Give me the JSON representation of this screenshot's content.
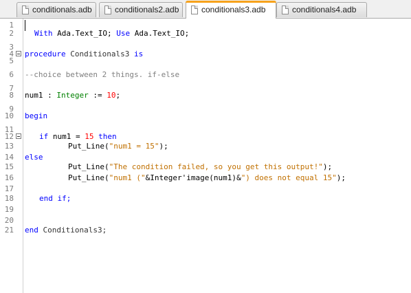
{
  "tabs": [
    {
      "label": "conditionals.adb",
      "active": false
    },
    {
      "label": "conditionals2.adb",
      "active": false
    },
    {
      "label": "conditionals3.adb",
      "active": true
    },
    {
      "label": "conditionals4.adb",
      "active": false
    }
  ],
  "editor": {
    "line_numbers": [
      "1",
      "2",
      "3",
      "4",
      "5",
      "6",
      "7",
      "8",
      "9",
      "10",
      "11",
      "12",
      "13",
      "14",
      "15",
      "16",
      "17",
      "18",
      "19",
      "20",
      "21"
    ],
    "lines": {
      "l2": {
        "with": "With",
        "pkg1": "Ada.Text_IO;",
        "use": "Use",
        "pkg2": "Ada.Text_IO;"
      },
      "l4": {
        "kw": "procedure",
        "name": "Conditionals3",
        "is": "is"
      },
      "l6": {
        "comment": "--choice between 2 things. if-else"
      },
      "l8": {
        "var": "num1 :",
        "type": "Integer",
        "assign": ":=",
        "value": "10",
        "semi": ";"
      },
      "l10": {
        "kw": "begin"
      },
      "l12": {
        "if": "if",
        "cond": "num1 =",
        "value": "15",
        "then": "then"
      },
      "l13": {
        "call": "Put_Line(",
        "str": "\"num1 = 15\"",
        "end": ");"
      },
      "l14": {
        "kw": "else"
      },
      "l15": {
        "call": "Put_Line(",
        "str": "\"The condition failed, so you get this output!\"",
        "end": ");"
      },
      "l16": {
        "call": "Put_Line(",
        "str1": "\"num1 (\"",
        "amp1": "&",
        "mid": "Integer'image(num1)",
        "amp2": "&",
        "str2": "\") does not equal 15\"",
        "end": ");"
      },
      "l18": {
        "kw": "end if;"
      },
      "l21": {
        "end": "end",
        "name": "Conditionals3;"
      }
    }
  },
  "colors": {
    "keyword": "#0000ff",
    "type": "#008000",
    "number": "#ff0000",
    "string": "#c07000",
    "comment": "#808080",
    "active_tab_accent": "#f7a21b"
  }
}
